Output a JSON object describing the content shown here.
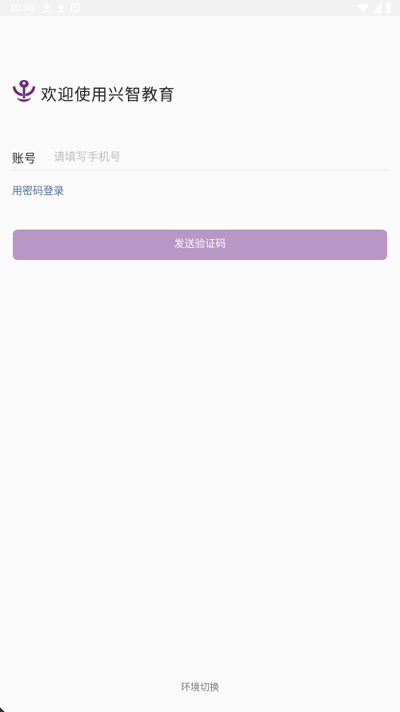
{
  "status_bar": {
    "time": "10:06",
    "icons": [
      "download-icon",
      "download-icon",
      "notification-box-icon"
    ],
    "right_icons": [
      "wifi-icon",
      "signal-icon",
      "battery-icon"
    ]
  },
  "header": {
    "logo": "xingzhi-logo-icon",
    "welcome_text": "欢迎使用兴智教育"
  },
  "form": {
    "account_label": "账号",
    "phone_placeholder": "请填写手机号",
    "phone_value": "",
    "password_login_link": "用密码登录",
    "send_code_button": "发送验证码"
  },
  "footer": {
    "env_switch": "环境切换"
  },
  "colors": {
    "background": "#fafafa",
    "button": "#b896c6",
    "link": "#4a6f9c",
    "logo": "#6b2a78"
  }
}
